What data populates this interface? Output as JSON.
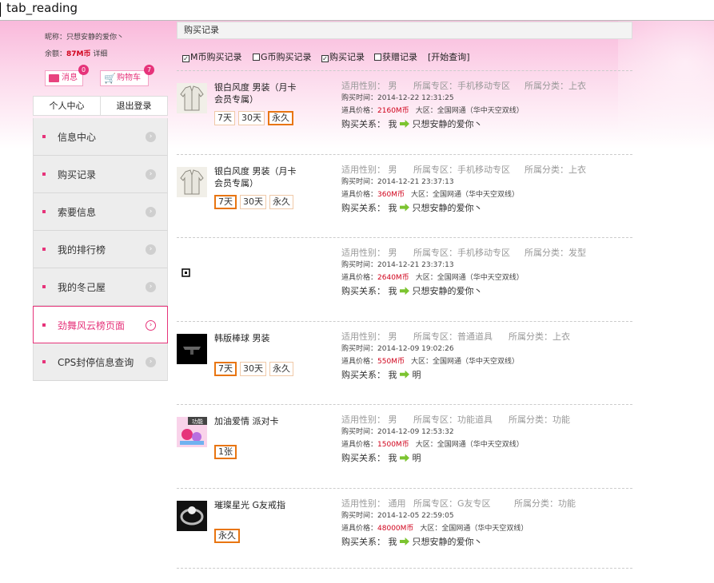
{
  "tab": {
    "title": "tab_reading"
  },
  "user": {
    "nickname_line": "昵称：只想安静的爱你丶",
    "balance_prefix": "余额：",
    "balance_value": "87M币",
    "balance_suffix": " 详细",
    "messages_label": "消息",
    "messages_count": "0",
    "cart_label": "购物车",
    "cart_count": "7"
  },
  "account": {
    "center": "个人中心",
    "logout": "退出登录"
  },
  "menu": [
    {
      "label": "信息中心"
    },
    {
      "label": "购买记录"
    },
    {
      "label": "索要信息"
    },
    {
      "label": "我的排行榜"
    },
    {
      "label": "我的冬己屋"
    },
    {
      "label": "劲舞风云榜页面"
    },
    {
      "label": "CPS封停信息查询"
    }
  ],
  "header": {
    "title": "购买记录"
  },
  "filters": {
    "m_purchase": "M币购买记录",
    "g_purchase": "G币购买记录",
    "purchase": "购买记录",
    "gift": "获赠记录",
    "start_query": "[开始查询]"
  },
  "records": [
    {
      "name": "银白风度 男装（月卡会员专属）",
      "options": [
        "7天",
        "30天",
        "永久"
      ],
      "selected": 2,
      "gender": "适用性别： 男",
      "zone": "所属专区：手机移动专区",
      "category": "所属分类：上衣",
      "time": "购买时间：2014-12-22 12:31:25",
      "price_prefix": "道具价格：",
      "price": "2160M币",
      "server": "大区：全国网通（华中天空双线）",
      "relation_prefix": "购买关系：  我 ",
      "relation_target": "只想安静的爱你丶"
    },
    {
      "name": "银白风度 男装（月卡会员专属）",
      "options": [
        "7天",
        "30天",
        "永久"
      ],
      "selected": 0,
      "gender": "适用性别： 男",
      "zone": "所属专区：手机移动专区",
      "category": "所属分类：上衣",
      "time": "购买时间：2014-12-21 23:37:13",
      "price_prefix": "道具价格：",
      "price": "360M币",
      "server": "大区：全国网通（华中天空双线）",
      "relation_prefix": "购买关系：  我 ",
      "relation_target": "只想安静的爱你丶"
    },
    {
      "name": "",
      "options": [],
      "selected": -1,
      "gender": "适用性别： 男",
      "zone": "所属专区：手机移动专区",
      "category": "所属分类：发型",
      "time": "购买时间：2014-12-21 23:37:13",
      "price_prefix": "道具价格：",
      "price": "2640M币",
      "server": "大区：全国网通（华中天空双线）",
      "relation_prefix": "购买关系：  我 ",
      "relation_target": "只想安静的爱你丶"
    },
    {
      "name": "韩版棒球 男装",
      "options": [
        "7天",
        "30天",
        "永久"
      ],
      "selected": 0,
      "gender": "适用性别： 男",
      "zone": "所属专区：普通道具",
      "category": "所属分类：上衣",
      "time": "购买时间：2014-12-09 19:02:26",
      "price_prefix": "道具价格：",
      "price": "550M币",
      "server": "大区：全国网通（华中天空双线）",
      "relation_prefix": "购买关系：  我 ",
      "relation_target": "明"
    },
    {
      "name": "加油爱情 派对卡",
      "options": [
        "1张"
      ],
      "selected": 0,
      "gender": "适用性别： 男",
      "zone": "所属专区：功能道具",
      "category": "所属分类：功能",
      "time": "购买时间：2014-12-09 12:53:32",
      "price_prefix": "道具价格：",
      "price": "1500M币",
      "server": "大区：全国网通（华中天空双线）",
      "relation_prefix": "购买关系：  我 ",
      "relation_target": "明"
    },
    {
      "name": "璀璨星光 G友戒指",
      "options": [
        "永久"
      ],
      "selected": 0,
      "gender": "适用性别： 通用",
      "zone": "所属专区：G友专区",
      "category": "所属分类：功能",
      "time": "购买时间：2014-12-05 22:59:05",
      "price_prefix": "道具价格：",
      "price": "48000M币",
      "server": "大区：全国网通（华中天空双线）",
      "relation_prefix": "购买关系：  我 ",
      "relation_target": "只想安静的爱你丶"
    }
  ],
  "thumb_labels": {
    "card": "功能"
  },
  "colors": {
    "accent": "#e6337a",
    "price": "#d0021b",
    "selected_option": "#e87511",
    "arrow": "#7cc430"
  }
}
